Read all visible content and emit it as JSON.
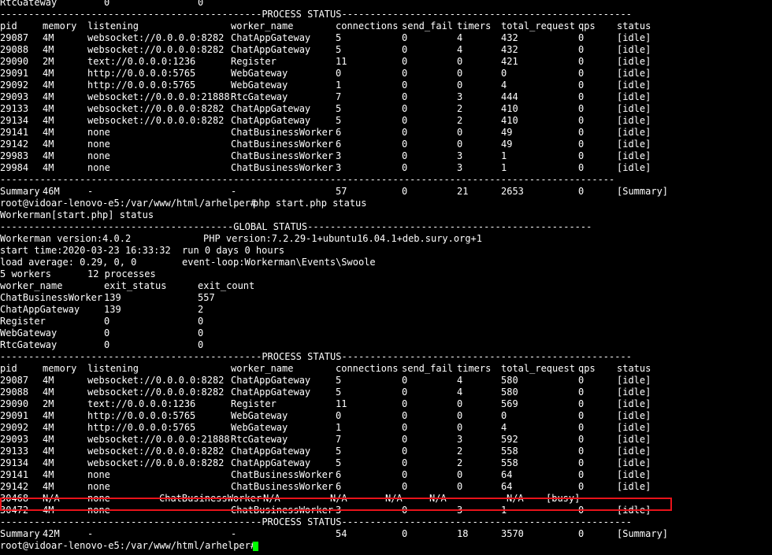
{
  "terminal": {
    "prompt_host": "root@vidoar-lenovo-e5:/var/www/html/arhelper#",
    "command": "php start.php status",
    "banner": "Workerman[start.php] status"
  },
  "sections": {
    "process_status_divider": "----------------------------------------------PROCESS STATUS---------------------------------------------------",
    "global_status_divider": "-----------------------------------------GLOBAL STATUS--------------------------------------------------",
    "plain_divider": "------------------------------------------------------------------------------------------------------------"
  },
  "columns": [
    "pid",
    "memory",
    "listening",
    "worker_name",
    "connections",
    "send_fail",
    "timers",
    "total_request",
    "qps",
    "status"
  ],
  "top_partial_row": [
    "RtcGateway",
    "0",
    "0"
  ],
  "table1": [
    [
      "29087",
      "4M",
      "websocket://0.0.0.0:8282",
      "ChatAppGateway",
      "5",
      "0",
      "4",
      "432",
      "0",
      "[idle]"
    ],
    [
      "29088",
      "4M",
      "websocket://0.0.0.0:8282",
      "ChatAppGateway",
      "5",
      "0",
      "4",
      "432",
      "0",
      "[idle]"
    ],
    [
      "29090",
      "2M",
      "text://0.0.0.0:1236",
      "Register",
      "11",
      "0",
      "0",
      "421",
      "0",
      "[idle]"
    ],
    [
      "29091",
      "4M",
      "http://0.0.0.0:5765",
      "WebGateway",
      "0",
      "0",
      "0",
      "0",
      "0",
      "[idle]"
    ],
    [
      "29092",
      "4M",
      "http://0.0.0.0:5765",
      "WebGateway",
      "1",
      "0",
      "0",
      "4",
      "0",
      "[idle]"
    ],
    [
      "29093",
      "4M",
      "websocket://0.0.0.0:21888",
      "RtcGateway",
      "7",
      "0",
      "3",
      "444",
      "0",
      "[idle]"
    ],
    [
      "29133",
      "4M",
      "websocket://0.0.0.0:8282",
      "ChatAppGateway",
      "5",
      "0",
      "2",
      "410",
      "0",
      "[idle]"
    ],
    [
      "29134",
      "4M",
      "websocket://0.0.0.0:8282",
      "ChatAppGateway",
      "5",
      "0",
      "2",
      "410",
      "0",
      "[idle]"
    ],
    [
      "29141",
      "4M",
      "none",
      "ChatBusinessWorker",
      "6",
      "0",
      "0",
      "49",
      "0",
      "[idle]"
    ],
    [
      "29142",
      "4M",
      "none",
      "ChatBusinessWorker",
      "6",
      "0",
      "0",
      "49",
      "0",
      "[idle]"
    ],
    [
      "29983",
      "4M",
      "none",
      "ChatBusinessWorker",
      "3",
      "0",
      "3",
      "1",
      "0",
      "[idle]"
    ],
    [
      "29984",
      "4M",
      "none",
      "ChatBusinessWorker",
      "3",
      "0",
      "3",
      "1",
      "0",
      "[idle]"
    ]
  ],
  "summary1": [
    "Summary",
    "46M",
    "-",
    "-",
    "57",
    "0",
    "21",
    "2653",
    "0",
    "[Summary]"
  ],
  "global": {
    "workerman_version": "Workerman version:4.0.2",
    "php_version": "PHP version:7.2.29-1+ubuntu16.04.1+deb.sury.org+1",
    "start_time": "start time:2020-03-23 16:33:32",
    "run_time": "run 0 days 0 hours",
    "load_average": "load average: 0.29, 0, 0",
    "event_loop": "event-loop:Workerman\\Events\\Swoole",
    "workers": "5 workers",
    "processes": "12 processes",
    "exit_headers": [
      "worker_name",
      "exit_status",
      "exit_count"
    ],
    "exit_rows": [
      [
        "ChatBusinessWorker",
        "139",
        "557"
      ],
      [
        "ChatAppGateway",
        "139",
        "2"
      ],
      [
        "Register",
        "0",
        "0"
      ],
      [
        "WebGateway",
        "0",
        "0"
      ],
      [
        "RtcGateway",
        "0",
        "0"
      ]
    ]
  },
  "table2": [
    [
      "29087",
      "4M",
      "websocket://0.0.0.0:8282",
      "ChatAppGateway",
      "5",
      "0",
      "4",
      "580",
      "0",
      "[idle]"
    ],
    [
      "29088",
      "4M",
      "websocket://0.0.0.0:8282",
      "ChatAppGateway",
      "5",
      "0",
      "4",
      "580",
      "0",
      "[idle]"
    ],
    [
      "29090",
      "2M",
      "text://0.0.0.0:1236",
      "Register",
      "11",
      "0",
      "0",
      "569",
      "0",
      "[idle]"
    ],
    [
      "29091",
      "4M",
      "http://0.0.0.0:5765",
      "WebGateway",
      "0",
      "0",
      "0",
      "0",
      "0",
      "[idle]"
    ],
    [
      "29092",
      "4M",
      "http://0.0.0.0:5765",
      "WebGateway",
      "1",
      "0",
      "0",
      "4",
      "0",
      "[idle]"
    ],
    [
      "29093",
      "4M",
      "websocket://0.0.0.0:21888",
      "RtcGateway",
      "7",
      "0",
      "3",
      "592",
      "0",
      "[idle]"
    ],
    [
      "29133",
      "4M",
      "websocket://0.0.0.0:8282",
      "ChatAppGateway",
      "5",
      "0",
      "2",
      "558",
      "0",
      "[idle]"
    ],
    [
      "29134",
      "4M",
      "websocket://0.0.0.0:8282",
      "ChatAppGateway",
      "5",
      "0",
      "2",
      "558",
      "0",
      "[idle]"
    ],
    [
      "29141",
      "4M",
      "none",
      "ChatBusinessWorker",
      "6",
      "0",
      "0",
      "64",
      "0",
      "[idle]"
    ],
    [
      "29142",
      "4M",
      "none",
      "ChatBusinessWorker",
      "6",
      "0",
      "0",
      "64",
      "0",
      "[idle]"
    ]
  ],
  "busy_row": [
    "30468",
    "N/A",
    "none",
    "ChatBusinessWorker",
    "N/A",
    "N/A",
    "N/A",
    "N/A",
    "N/A",
    "[busy]"
  ],
  "after_busy_row": [
    "30472",
    "4M",
    "none",
    "ChatBusinessWorker",
    "3",
    "0",
    "3",
    "1",
    "0",
    "[idle]"
  ],
  "summary2": [
    "Summary",
    "42M",
    "-",
    "-",
    "54",
    "0",
    "18",
    "3570",
    "0",
    "[Summary]"
  ],
  "colors": {
    "background": "#000000",
    "text": "#ffffff",
    "highlight": "#e8131a",
    "cursor": "#00ff00"
  }
}
